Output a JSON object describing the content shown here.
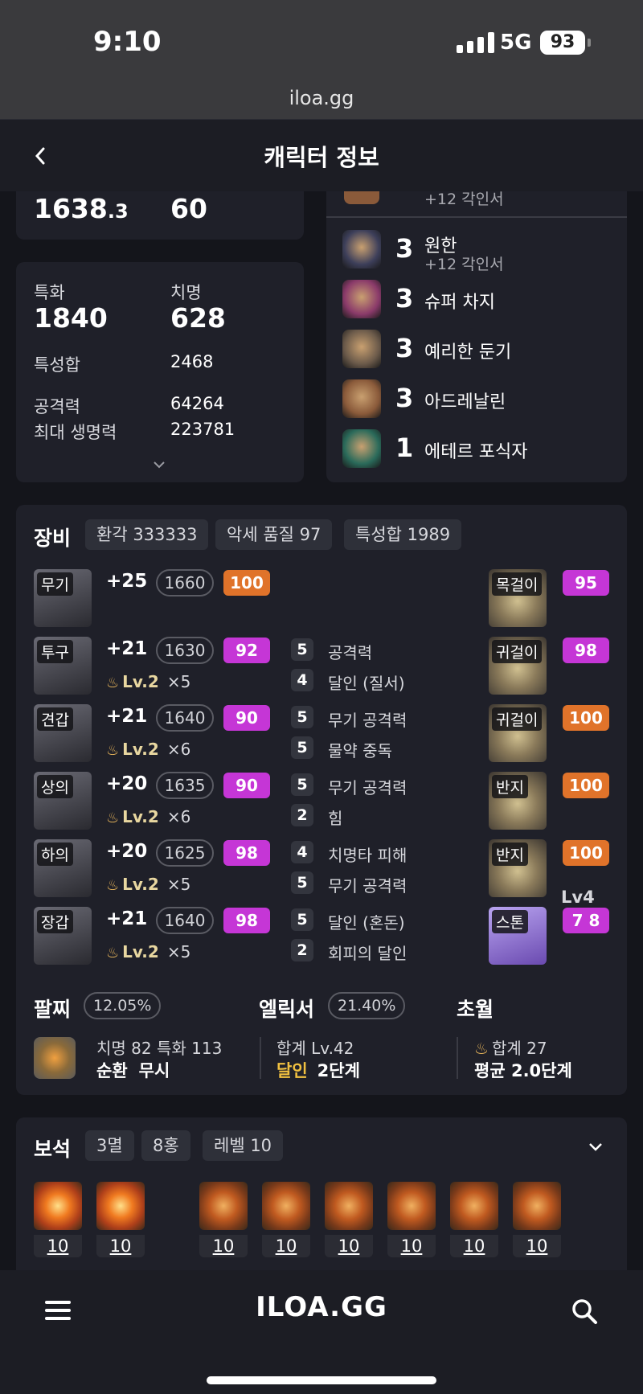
{
  "status": {
    "time": "9:10",
    "network": "5G",
    "battery": "93"
  },
  "url": "iloa.gg",
  "header": {
    "title": "캐릭터 정보"
  },
  "stats_top": {
    "left_value": "1638",
    "left_decimal": ".3",
    "right_value": "60"
  },
  "stats": {
    "spec_label": "특화",
    "spec_value": "1840",
    "crit_label": "치명",
    "crit_value": "628",
    "total_label": "특성합",
    "total_value": "2468",
    "atk_label": "공격력",
    "atk_value": "64264",
    "hp_label": "최대 생명력",
    "hp_value": "223781"
  },
  "engravings": {
    "partial_sub": "+12 각인서",
    "items": [
      {
        "level": "3",
        "name": "원한",
        "sub": "+12 각인서",
        "icon": "wolf-icon",
        "color": "#3d3f5a"
      },
      {
        "level": "3",
        "name": "슈퍼 차지",
        "sub": "",
        "icon": "charge-icon",
        "color": "#8a3a6a"
      },
      {
        "level": "3",
        "name": "예리한 둔기",
        "sub": "",
        "icon": "mace-icon",
        "color": "#6b5a4a"
      },
      {
        "level": "3",
        "name": "아드레날린",
        "sub": "",
        "icon": "adrenaline-icon",
        "color": "#8a5a3a"
      },
      {
        "level": "1",
        "name": "에테르 포식자",
        "sub": "",
        "icon": "ether-icon",
        "color": "#2a6a5a"
      }
    ]
  },
  "equipment": {
    "title": "장비",
    "chips": [
      "환각 333333",
      "악세 품질 97",
      "특성합 1989"
    ],
    "armor": [
      {
        "slot": "무기",
        "enh": "+25",
        "ilvl": "1660",
        "quality": "100",
        "qcolor": "orange",
        "lv": "",
        "mult": "",
        "effects": []
      },
      {
        "slot": "투구",
        "enh": "+21",
        "ilvl": "1630",
        "quality": "92",
        "qcolor": "purple",
        "lv": "Lv.2",
        "mult": "×5",
        "effects": [
          [
            "5",
            "공격력"
          ],
          [
            "4",
            "달인 (질서)"
          ]
        ]
      },
      {
        "slot": "견갑",
        "enh": "+21",
        "ilvl": "1640",
        "quality": "90",
        "qcolor": "purple",
        "lv": "Lv.2",
        "mult": "×6",
        "effects": [
          [
            "5",
            "무기 공격력"
          ],
          [
            "5",
            "물약 중독"
          ]
        ]
      },
      {
        "slot": "상의",
        "enh": "+20",
        "ilvl": "1635",
        "quality": "90",
        "qcolor": "purple",
        "lv": "Lv.2",
        "mult": "×6",
        "effects": [
          [
            "5",
            "무기 공격력"
          ],
          [
            "2",
            "힘"
          ]
        ]
      },
      {
        "slot": "하의",
        "enh": "+20",
        "ilvl": "1625",
        "quality": "98",
        "qcolor": "purple",
        "lv": "Lv.2",
        "mult": "×5",
        "effects": [
          [
            "4",
            "치명타 피해"
          ],
          [
            "5",
            "무기 공격력"
          ]
        ]
      },
      {
        "slot": "장갑",
        "enh": "+21",
        "ilvl": "1640",
        "quality": "98",
        "qcolor": "purple",
        "lv": "Lv.2",
        "mult": "×5",
        "effects": [
          [
            "5",
            "달인 (혼돈)"
          ],
          [
            "2",
            "회피의 달인"
          ]
        ]
      }
    ],
    "accessories": [
      {
        "slot": "목걸이",
        "quality": "95",
        "qcolor": "purple"
      },
      {
        "slot": "귀걸이",
        "quality": "98",
        "qcolor": "purple"
      },
      {
        "slot": "귀걸이",
        "quality": "100",
        "qcolor": "orange"
      },
      {
        "slot": "반지",
        "quality": "100",
        "qcolor": "orange"
      },
      {
        "slot": "반지",
        "quality": "100",
        "qcolor": "orange"
      },
      {
        "slot": "스톤",
        "quality": "7 8",
        "qcolor": "purple"
      }
    ],
    "stone_level": "Lv4"
  },
  "bracelet": {
    "title": "팔찌",
    "pct": "12.05%",
    "line1": "치명 82  특화 113",
    "line2a": "순환",
    "line2b": "무시"
  },
  "elixir": {
    "title": "엘릭서",
    "pct": "21.40%",
    "line1": "합계 Lv.42",
    "line2a": "달인",
    "line2b": "2단계"
  },
  "transcend": {
    "title": "초월",
    "line1": "합계 27",
    "line2": "평균 2.0단계"
  },
  "gems": {
    "title": "보석",
    "chips": [
      "3멸",
      "8홍",
      "레벨 10"
    ],
    "items": [
      {
        "level": "10",
        "type": "doom"
      },
      {
        "level": "10",
        "type": "doom"
      },
      {
        "level": "10",
        "type": "crimson"
      },
      {
        "level": "10",
        "type": "crimson"
      },
      {
        "level": "10",
        "type": "crimson"
      },
      {
        "level": "10",
        "type": "crimson"
      },
      {
        "level": "10",
        "type": "crimson"
      },
      {
        "level": "10",
        "type": "crimson"
      }
    ]
  },
  "nav": {
    "logo": "ILOA.GG"
  },
  "colors": {
    "orange": "#e0732a",
    "purple": "#c536d6",
    "bg": "#14151b",
    "card": "#1f2029"
  }
}
